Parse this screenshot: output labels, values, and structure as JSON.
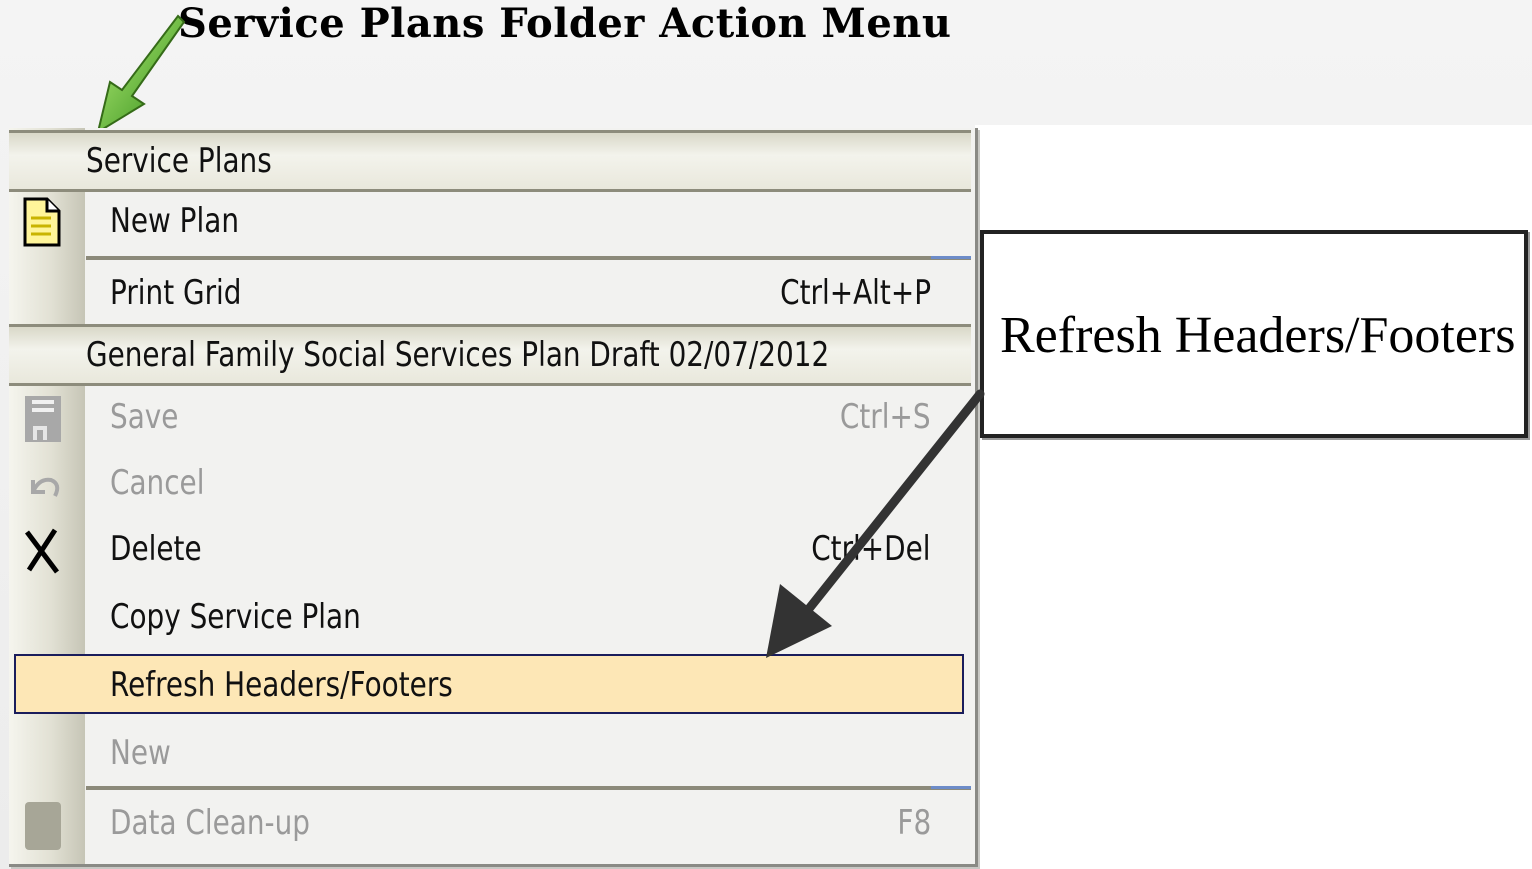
{
  "title": "Service Plans Folder Action Menu",
  "menu": {
    "section1_header": "Service Plans",
    "new_plan": "New Plan",
    "print_grid": "Print Grid",
    "print_grid_shortcut": "Ctrl+Alt+P",
    "section2_header": "General Family Social Services Plan Draft 02/07/2012",
    "save": "Save",
    "save_shortcut": "Ctrl+S",
    "cancel": "Cancel",
    "delete": "Delete",
    "delete_shortcut": "Ctrl+Del",
    "copy": "Copy Service Plan",
    "refresh": "Refresh Headers/Footers",
    "new": "New",
    "data_cleanup": "Data Clean-up",
    "data_cleanup_shortcut": "F8"
  },
  "callout": {
    "text": "Refresh Headers/Footers"
  },
  "icons": [
    "document-icon",
    "save-icon",
    "undo-icon",
    "delete-x-icon",
    "cleanup-icon"
  ],
  "colors": {
    "highlight": "#fde7b6",
    "highlight_border": "#1a1d5c",
    "arrow_green": "#4caf2a"
  }
}
